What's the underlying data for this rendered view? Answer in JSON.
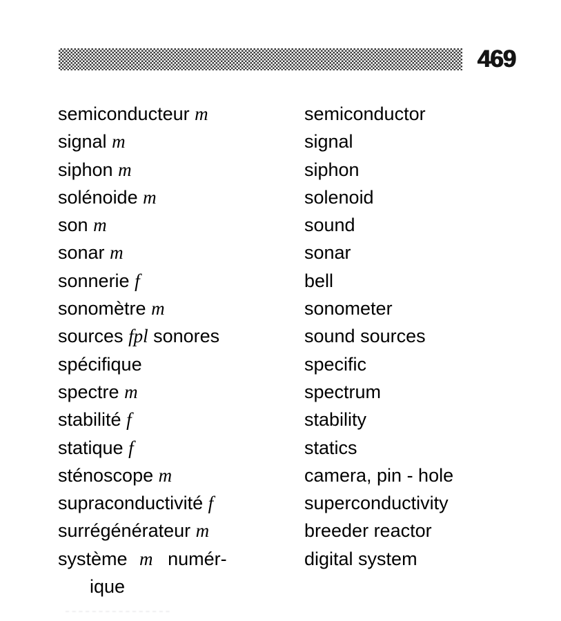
{
  "page": {
    "number": "469",
    "header_bar": {
      "pattern": "halftone-checkerboard",
      "color": "#2b2b2b"
    },
    "background_color": "#ffffff",
    "text_color": "#000000"
  },
  "columns": {
    "source_language": "French",
    "target_language": "English"
  },
  "entries": [
    {
      "fr": "semiconducteur",
      "marker": "m",
      "fr_tail": "",
      "en": "semiconductor"
    },
    {
      "fr": "signal",
      "marker": "m",
      "fr_tail": "",
      "en": "signal"
    },
    {
      "fr": "siphon",
      "marker": "m",
      "fr_tail": "",
      "en": "siphon"
    },
    {
      "fr": "solénoide",
      "marker": "m",
      "fr_tail": "",
      "en": "solenoid"
    },
    {
      "fr": "son",
      "marker": "m",
      "fr_tail": "",
      "en": "sound"
    },
    {
      "fr": "sonar",
      "marker": "m",
      "fr_tail": "",
      "en": "sonar"
    },
    {
      "fr": "sonnerie",
      "marker": "f",
      "fr_tail": "",
      "en": "bell"
    },
    {
      "fr": "sonomètre",
      "marker": "m",
      "fr_tail": "",
      "en": "sonometer"
    },
    {
      "fr": "sources",
      "marker": "fpl",
      "fr_tail": "sonores",
      "en": "sound sources"
    },
    {
      "fr": "spécifique",
      "marker": "",
      "fr_tail": "",
      "en": "specific"
    },
    {
      "fr": "spectre",
      "marker": "m",
      "fr_tail": "",
      "en": "spectrum"
    },
    {
      "fr": "stabilité",
      "marker": "f",
      "fr_tail": "",
      "en": "stability"
    },
    {
      "fr": "statique",
      "marker": "f",
      "fr_tail": "",
      "en": "statics"
    },
    {
      "fr": "sténoscope",
      "marker": "m",
      "fr_tail": "",
      "en": "camera, pin - hole"
    },
    {
      "fr": "supraconductivité",
      "marker": "f",
      "fr_tail": "",
      "en": "superconductivity"
    },
    {
      "fr": "surrégénérateur",
      "marker": "m",
      "fr_tail": "",
      "en": "breeder reactor"
    },
    {
      "fr": "système",
      "marker": "m",
      "fr_tail": "numér-",
      "fr_continuation": "ique",
      "en": "digital system"
    }
  ],
  "artifacts": {
    "bleed_through_text": "ـ ـ ـ ـ ـ ـ ـ ـ ـ ـ ـ ـ ـ ـ ـ ـ"
  }
}
